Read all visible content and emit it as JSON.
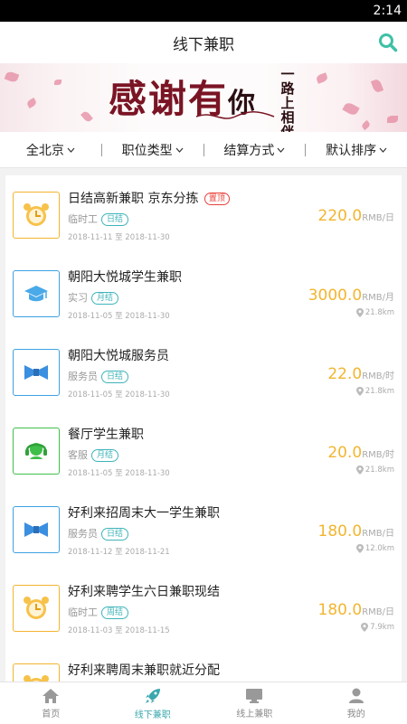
{
  "status": {
    "time": "2:14"
  },
  "header": {
    "title": "线下兼职"
  },
  "banner": {
    "main": "感谢有",
    "small": "你",
    "vertical": "一路上相伴"
  },
  "filters": [
    {
      "label": "全北京"
    },
    {
      "label": "职位类型"
    },
    {
      "label": "结算方式"
    },
    {
      "label": "默认排序"
    }
  ],
  "jobs": [
    {
      "title": "日结高新兼职 京东分拣",
      "badge": "置顶",
      "type": "临时工",
      "settle": "日结",
      "date": "2018-11-11 至 2018-11-30",
      "price": "220.0",
      "unit": "RMB/日",
      "distance": "",
      "icon": "alarm-clock-icon",
      "color": "#f2b52f"
    },
    {
      "title": "朝阳大悦城学生兼职",
      "badge": "",
      "type": "实习",
      "settle": "月结",
      "date": "2018-11-05 至 2018-11-30",
      "price": "3000.0",
      "unit": "RMB/月",
      "distance": "21.8km",
      "icon": "graduation-cap-icon",
      "color": "#3da1e3"
    },
    {
      "title": "朝阳大悦城服务员",
      "badge": "",
      "type": "服务员",
      "settle": "日结",
      "date": "2018-11-05 至 2018-11-30",
      "price": "22.0",
      "unit": "RMB/时",
      "distance": "21.8km",
      "icon": "bow-tie-icon",
      "color": "#3da1e3"
    },
    {
      "title": "餐厅学生兼职",
      "badge": "",
      "type": "客服",
      "settle": "月结",
      "date": "2018-11-05 至 2018-11-30",
      "price": "20.0",
      "unit": "RMB/时",
      "distance": "21.8km",
      "icon": "headset-icon",
      "color": "#3fbf4a"
    },
    {
      "title": "好利来招周末大一学生兼职",
      "badge": "",
      "type": "服务员",
      "settle": "日结",
      "date": "2018-11-12 至 2018-11-21",
      "price": "180.0",
      "unit": "RMB/日",
      "distance": "12.0km",
      "icon": "bow-tie-icon",
      "color": "#3da1e3"
    },
    {
      "title": "好利来聘学生六日兼职现结",
      "badge": "",
      "type": "临时工",
      "settle": "周结",
      "date": "2018-11-03 至 2018-11-15",
      "price": "180.0",
      "unit": "RMB/日",
      "distance": "7.9km",
      "icon": "alarm-clock-icon",
      "color": "#f2b52f"
    },
    {
      "title": "好利来聘周末兼职就近分配",
      "badge": "",
      "type": "",
      "settle": "",
      "date": "",
      "price": "",
      "unit": "",
      "distance": "",
      "icon": "alarm-clock-icon",
      "color": "#f2b52f"
    }
  ],
  "tabbar": [
    {
      "label": "首页",
      "icon": "home-icon"
    },
    {
      "label": "线下兼职",
      "icon": "rocket-icon",
      "active": true
    },
    {
      "label": "线上兼职",
      "icon": "monitor-icon"
    },
    {
      "label": "我的",
      "icon": "user-icon"
    }
  ],
  "colors": {
    "accent": "#3aa7ad",
    "price": "#f2b52f",
    "hot": "#e8423b"
  }
}
